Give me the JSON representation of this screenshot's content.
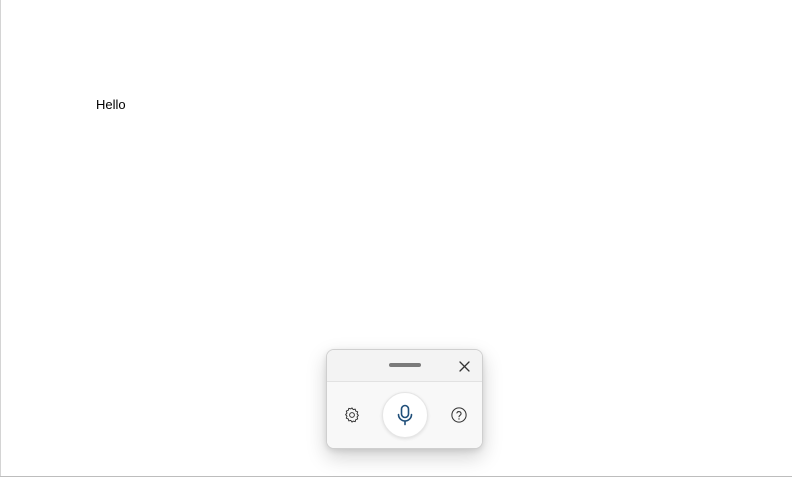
{
  "document": {
    "text": "Hello"
  },
  "voice_panel": {
    "icons": {
      "drag": "drag-handle-icon",
      "close": "close-icon",
      "settings": "gear-icon",
      "microphone": "microphone-icon",
      "help": "help-icon"
    },
    "colors": {
      "mic_accent": "#1f4e79",
      "icon": "#333333"
    }
  }
}
